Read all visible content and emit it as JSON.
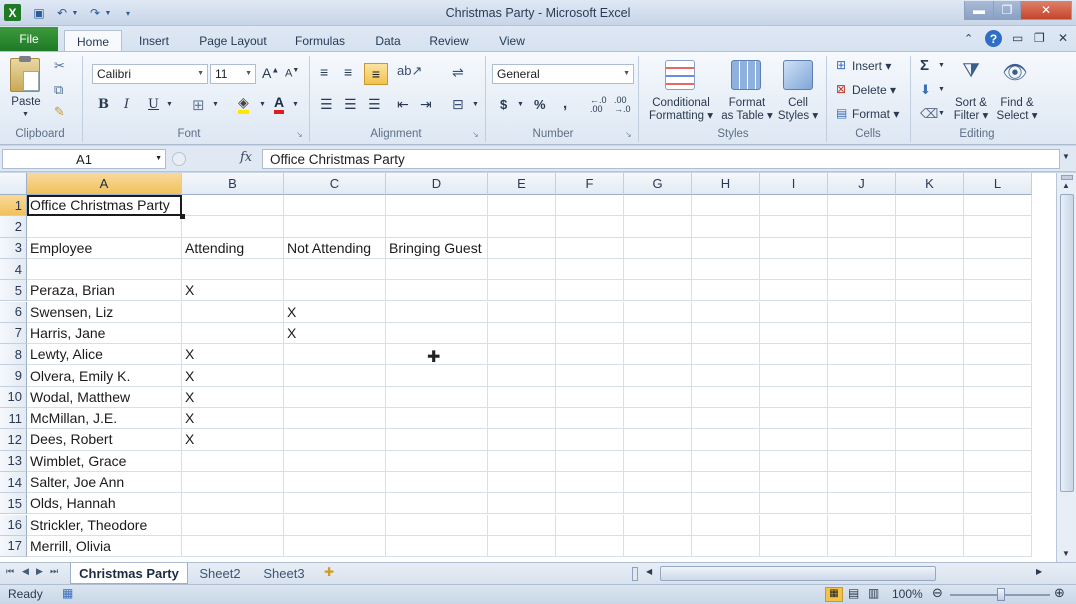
{
  "window": {
    "title": "Christmas Party  -  Microsoft Excel",
    "app_icon": "X",
    "colors": {
      "file_tab": "#2a8a2f",
      "selection_header": "#f1c15d",
      "ribbon": "#dde7f3"
    }
  },
  "tabs": {
    "file": "File",
    "items": [
      "Home",
      "Insert",
      "Page Layout",
      "Formulas",
      "Data",
      "Review",
      "View"
    ]
  },
  "ribbon": {
    "clipboard": {
      "paste": "Paste",
      "label": "Clipboard"
    },
    "font": {
      "name": "Calibri",
      "size": "11",
      "bold": "B",
      "italic": "I",
      "underline": "U",
      "label": "Font"
    },
    "alignment": {
      "label": "Alignment"
    },
    "number": {
      "format": "General",
      "currency": "$",
      "percent": "%",
      "comma": ",",
      "label": "Number"
    },
    "styles": {
      "conditional": "Conditional",
      "conditional2": "Formatting",
      "format_table": "Format",
      "format_table2": "as Table",
      "cell_styles": "Cell",
      "cell_styles2": "Styles",
      "label": "Styles"
    },
    "cells": {
      "insert": "Insert",
      "delete": "Delete",
      "format": "Format",
      "label": "Cells"
    },
    "editing": {
      "sigma": "Σ",
      "sort": "Sort &",
      "sort2": "Filter",
      "find": "Find &",
      "find2": "Select",
      "label": "Editing"
    }
  },
  "formula_bar": {
    "name_box": "A1",
    "fx": "fx",
    "value": "Office Christmas Party"
  },
  "grid": {
    "columns": [
      "A",
      "B",
      "C",
      "D",
      "E",
      "F",
      "G",
      "H",
      "I",
      "J",
      "K",
      "L"
    ],
    "selected_column": "A",
    "selected_row": "1",
    "rows": [
      {
        "n": "1",
        "cells": [
          "Office Christmas Party",
          "",
          "",
          ""
        ]
      },
      {
        "n": "2",
        "cells": [
          "",
          "",
          "",
          ""
        ]
      },
      {
        "n": "3",
        "cells": [
          "Employee",
          "Attending",
          "Not Attending",
          "Bringing Guest"
        ]
      },
      {
        "n": "4",
        "cells": [
          "",
          "",
          "",
          ""
        ]
      },
      {
        "n": "5",
        "cells": [
          "Peraza, Brian",
          "X",
          "",
          ""
        ]
      },
      {
        "n": "6",
        "cells": [
          "Swensen, Liz",
          "",
          "X",
          ""
        ]
      },
      {
        "n": "7",
        "cells": [
          "Harris, Jane",
          "",
          "X",
          ""
        ]
      },
      {
        "n": "8",
        "cells": [
          "Lewty, Alice",
          "X",
          "",
          ""
        ]
      },
      {
        "n": "9",
        "cells": [
          "Olvera, Emily K.",
          "X",
          "",
          ""
        ]
      },
      {
        "n": "10",
        "cells": [
          "Wodal, Matthew",
          "X",
          "",
          ""
        ]
      },
      {
        "n": "11",
        "cells": [
          "McMillan, J.E.",
          "X",
          "",
          ""
        ]
      },
      {
        "n": "12",
        "cells": [
          "Dees, Robert",
          "X",
          "",
          ""
        ]
      },
      {
        "n": "13",
        "cells": [
          "Wimblet, Grace",
          "",
          "",
          ""
        ]
      },
      {
        "n": "14",
        "cells": [
          "Salter, Joe Ann",
          "",
          "",
          ""
        ]
      },
      {
        "n": "15",
        "cells": [
          "Olds, Hannah",
          "",
          "",
          ""
        ]
      },
      {
        "n": "16",
        "cells": [
          "Strickler, Theodore",
          "",
          "",
          ""
        ]
      },
      {
        "n": "17",
        "cells": [
          "Merrill, Olivia",
          "",
          "",
          ""
        ]
      }
    ]
  },
  "sheets": {
    "tabs": [
      "Christmas Party",
      "Sheet2",
      "Sheet3"
    ],
    "active": "Christmas Party"
  },
  "status": {
    "mode": "Ready",
    "zoom": "100%"
  }
}
